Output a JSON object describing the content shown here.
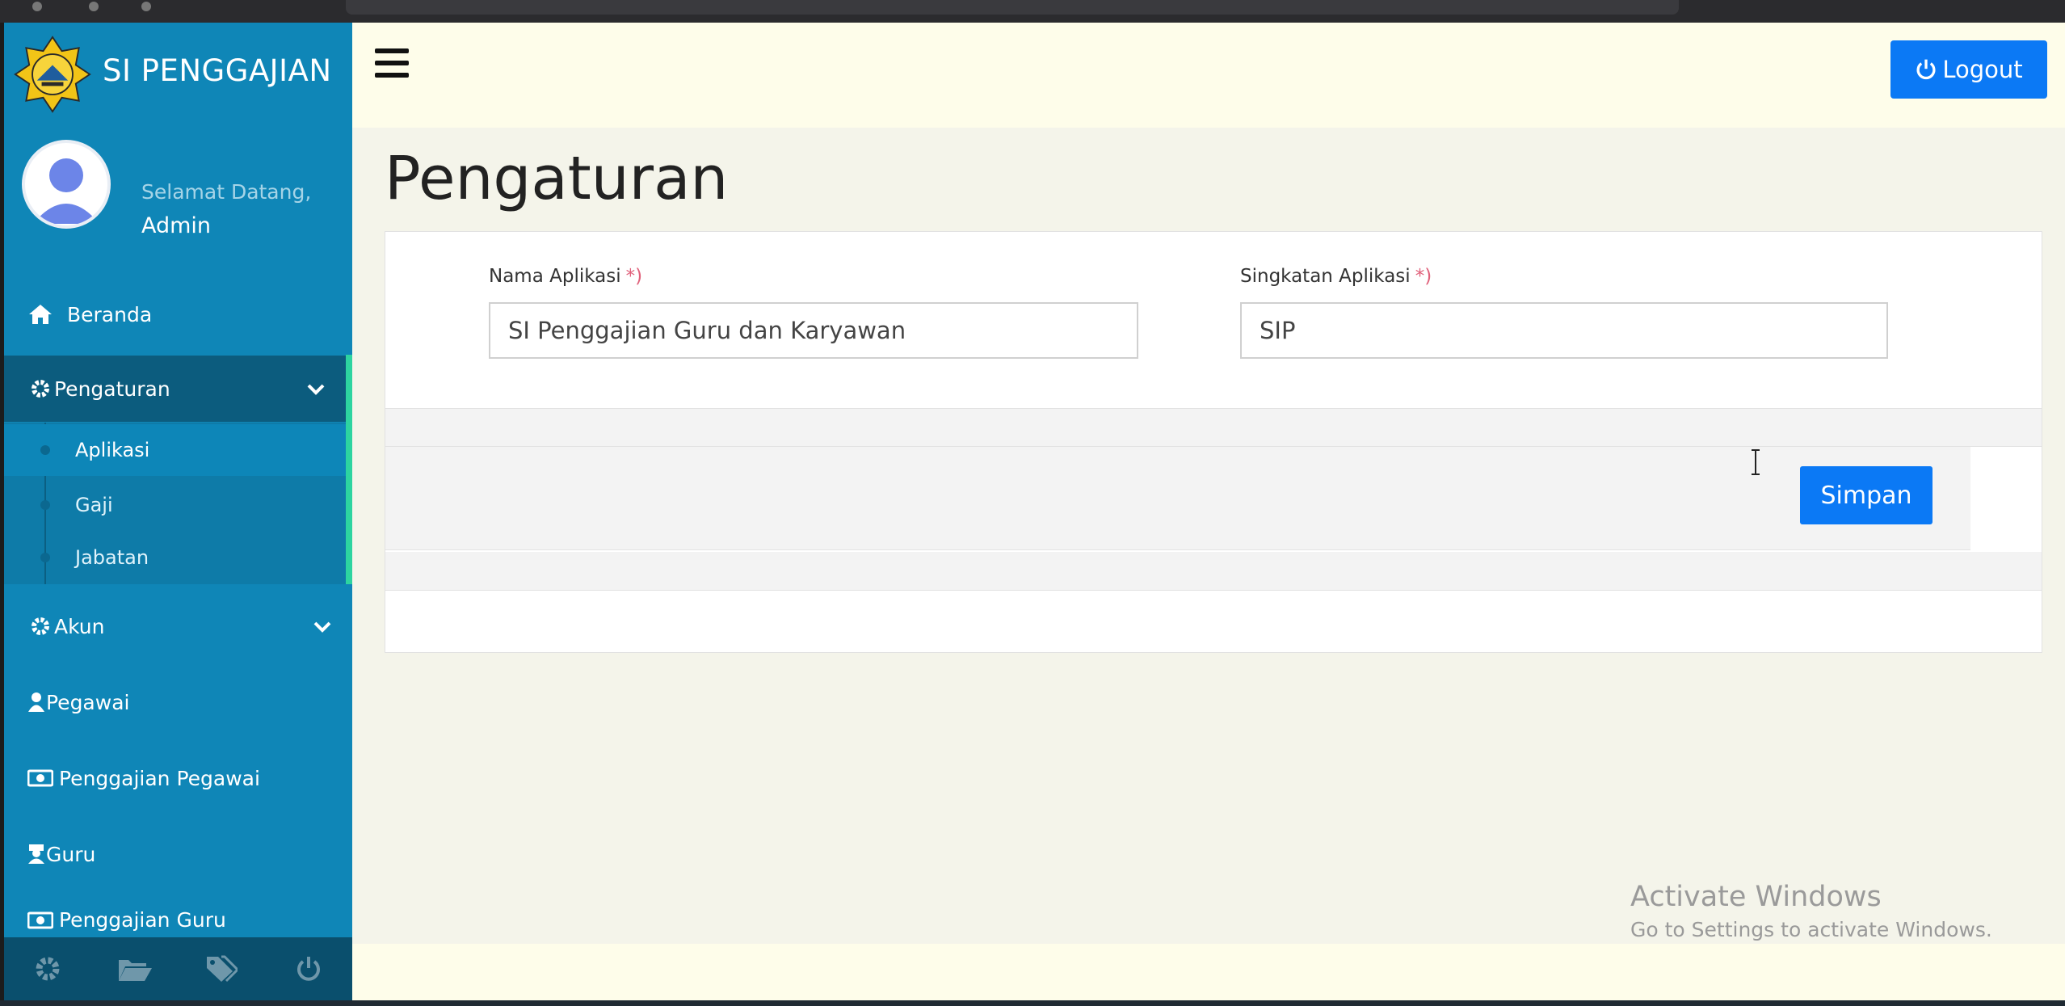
{
  "app": {
    "title": "SI PENGGAJIAN"
  },
  "user": {
    "greeting": "Selamat Datang,",
    "name": "Admin"
  },
  "sidebar": {
    "items": [
      {
        "label": "Beranda",
        "icon": "home-icon"
      },
      {
        "label": "Pengaturan",
        "icon": "gear-icon",
        "expanded": true
      },
      {
        "label": "Akun",
        "icon": "gear-icon",
        "expanded": false
      },
      {
        "label": "Pegawai",
        "icon": "user-tie-icon"
      },
      {
        "label": "Penggajian Pegawai",
        "icon": "money-bill-icon"
      },
      {
        "label": "Guru",
        "icon": "teacher-icon"
      },
      {
        "label": "Penggajian Guru",
        "icon": "money-bill-icon"
      }
    ],
    "submenu": [
      {
        "label": "Aplikasi",
        "active": true
      },
      {
        "label": "Gaji",
        "active": false
      },
      {
        "label": "Jabatan",
        "active": false
      }
    ],
    "footer_icons": [
      "gear-icon",
      "folder-open-icon",
      "tags-icon",
      "power-icon"
    ]
  },
  "header": {
    "logout_label": "Logout"
  },
  "page": {
    "title": "Pengaturan"
  },
  "form": {
    "nama_aplikasi": {
      "label": "Nama Aplikasi",
      "required_mark": "*)",
      "value": "SI Penggajian Guru dan Karyawan"
    },
    "singkatan_aplikasi": {
      "label": "Singkatan Aplikasi",
      "required_mark": "*)",
      "value": "SIP"
    },
    "save_label": "Simpan"
  },
  "watermark": {
    "line1": "Activate Windows",
    "line2": "Go to Settings to activate Windows."
  },
  "colors": {
    "sidebar_bg": "#0f86b7",
    "sidebar_active": "#0c5c7e",
    "primary_button": "#0b79f5",
    "topbar_bg": "#fefdea",
    "content_bg": "#f4f4ea",
    "submenu_accent": "#2dd4a0"
  }
}
